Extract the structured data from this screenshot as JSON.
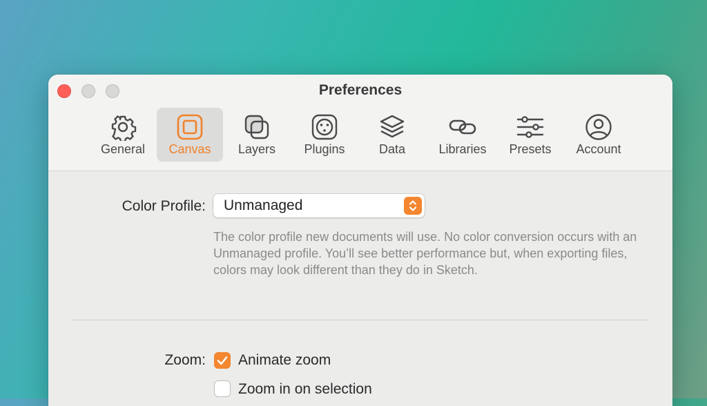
{
  "window": {
    "title": "Preferences"
  },
  "toolbar": {
    "items": [
      {
        "label": "General",
        "icon": "gear-icon"
      },
      {
        "label": "Canvas",
        "icon": "canvas-icon",
        "active": true
      },
      {
        "label": "Layers",
        "icon": "layers-icon"
      },
      {
        "label": "Plugins",
        "icon": "plugins-icon"
      },
      {
        "label": "Data",
        "icon": "data-stack-icon"
      },
      {
        "label": "Libraries",
        "icon": "link-icon"
      },
      {
        "label": "Presets",
        "icon": "sliders-icon"
      },
      {
        "label": "Account",
        "icon": "account-icon"
      }
    ]
  },
  "color_profile": {
    "label": "Color Profile:",
    "value": "Unmanaged",
    "help": "The color profile new documents will use. No color conversion occurs with an Unmanaged profile. You’ll see better performance but, when exporting files, colors may look different than they do in Sketch."
  },
  "zoom": {
    "label": "Zoom:",
    "options": [
      {
        "label": "Animate zoom",
        "checked": true
      },
      {
        "label": "Zoom in on selection",
        "checked": false
      }
    ]
  },
  "colors": {
    "accent": "#f3862f",
    "close": "#ff5f57"
  }
}
